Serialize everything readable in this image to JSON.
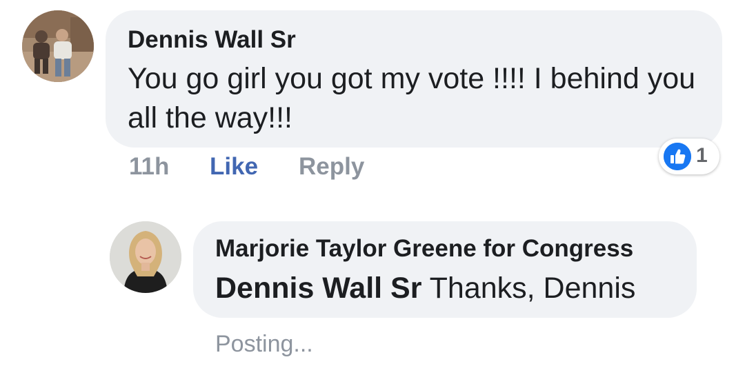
{
  "comment": {
    "author": "Dennis Wall Sr",
    "text": "You go girl you got my vote !!!! I behind you all the way!!!",
    "time": "11h",
    "like_label": "Like",
    "reply_label": "Reply",
    "reaction": {
      "icon": "thumbs-up-icon",
      "count": "1",
      "color": "#1877f2"
    }
  },
  "reply": {
    "author": "Marjorie Taylor Greene for Congress",
    "mention": "Dennis Wall Sr",
    "text": " Thanks, Dennis",
    "status": "Posting..."
  },
  "colors": {
    "bubble": "#f0f2f5",
    "like_blue": "#4267b2",
    "meta_gray": "#8d949e",
    "text": "#1c1e21"
  }
}
